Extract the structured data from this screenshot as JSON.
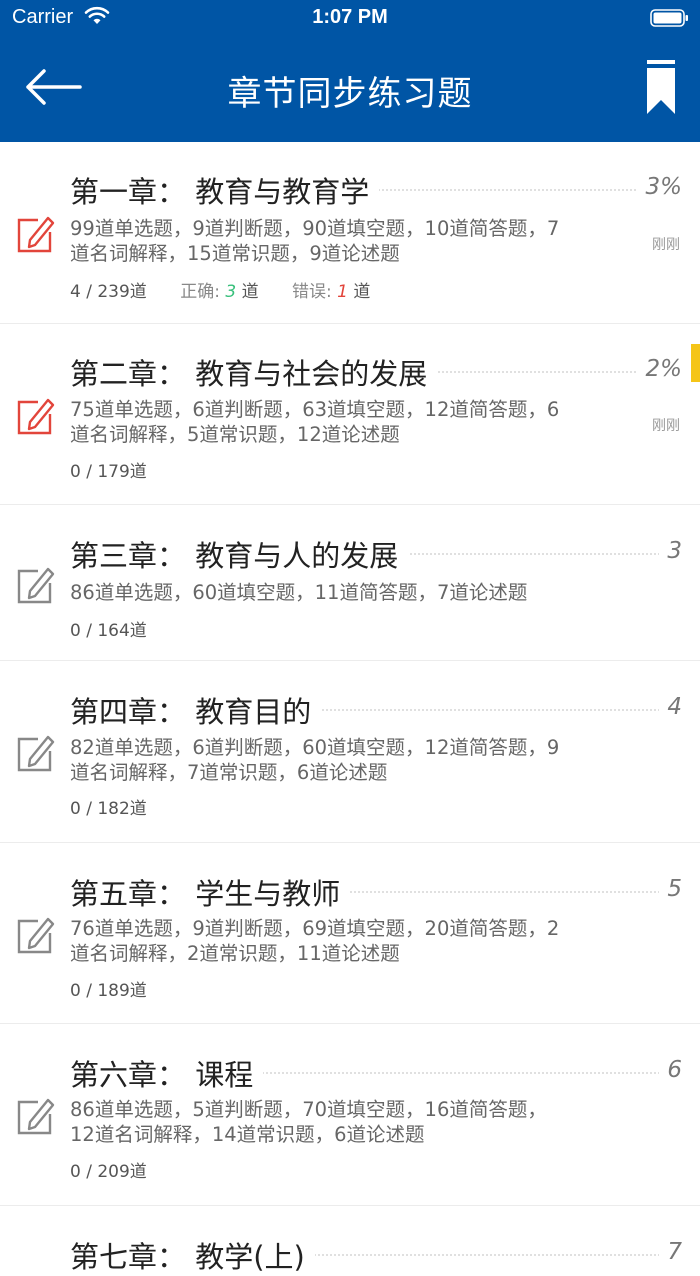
{
  "status_bar": {
    "carrier": "Carrier",
    "time": "1:07 PM"
  },
  "nav": {
    "title": "章节同步练习题"
  },
  "colors": {
    "header_bg": "#0055a5",
    "active_icon": "#e2453b",
    "inactive_icon": "#888888",
    "correct": "#39c07c",
    "wrong": "#e2453b",
    "bookmark_flag": "#f5c518"
  },
  "chapters": [
    {
      "title": "第一章：  教育与教育学",
      "progress": "3%",
      "desc": "99道单选题，9道判断题，90道填空题，10道简答题，7道名词解释，15道常识题，9道论述题",
      "count": "4 / 239道",
      "correct_label": "正确:",
      "correct": "3",
      "correct_unit": "道",
      "wrong_label": "错误:",
      "wrong": "1",
      "wrong_unit": "道",
      "time": "刚刚",
      "icon": "edit-icon-active"
    },
    {
      "title": "第二章：  教育与社会的发展",
      "progress": "2%",
      "desc": "75道单选题，6道判断题，63道填空题，12道简答题，6道名词解释，5道常识题，12道论述题",
      "count": "0 / 179道",
      "time": "刚刚",
      "icon": "edit-icon-active"
    },
    {
      "title": "第三章：  教育与人的发展",
      "progress": "3",
      "desc": "86道单选题，60道填空题，11道简答题，7道论述题",
      "count": "0 / 164道",
      "icon": "edit-icon"
    },
    {
      "title": "第四章：  教育目的",
      "progress": "4",
      "desc": "82道单选题，6道判断题，60道填空题，12道简答题，9道名词解释，7道常识题，6道论述题",
      "count": "0 / 182道",
      "icon": "edit-icon"
    },
    {
      "title": "第五章：  学生与教师",
      "progress": "5",
      "desc": "76道单选题，9道判断题，69道填空题，20道简答题，2道名词解释，2道常识题，11道论述题",
      "count": "0 / 189道",
      "icon": "edit-icon"
    },
    {
      "title": "第六章：  课程",
      "progress": "6",
      "desc": "86道单选题，5道判断题，70道填空题，16道简答题，12道名词解释，14道常识题，6道论述题",
      "count": "0 / 209道",
      "icon": "edit-icon"
    },
    {
      "title": "第七章：  教学(上)",
      "progress": "7"
    }
  ]
}
